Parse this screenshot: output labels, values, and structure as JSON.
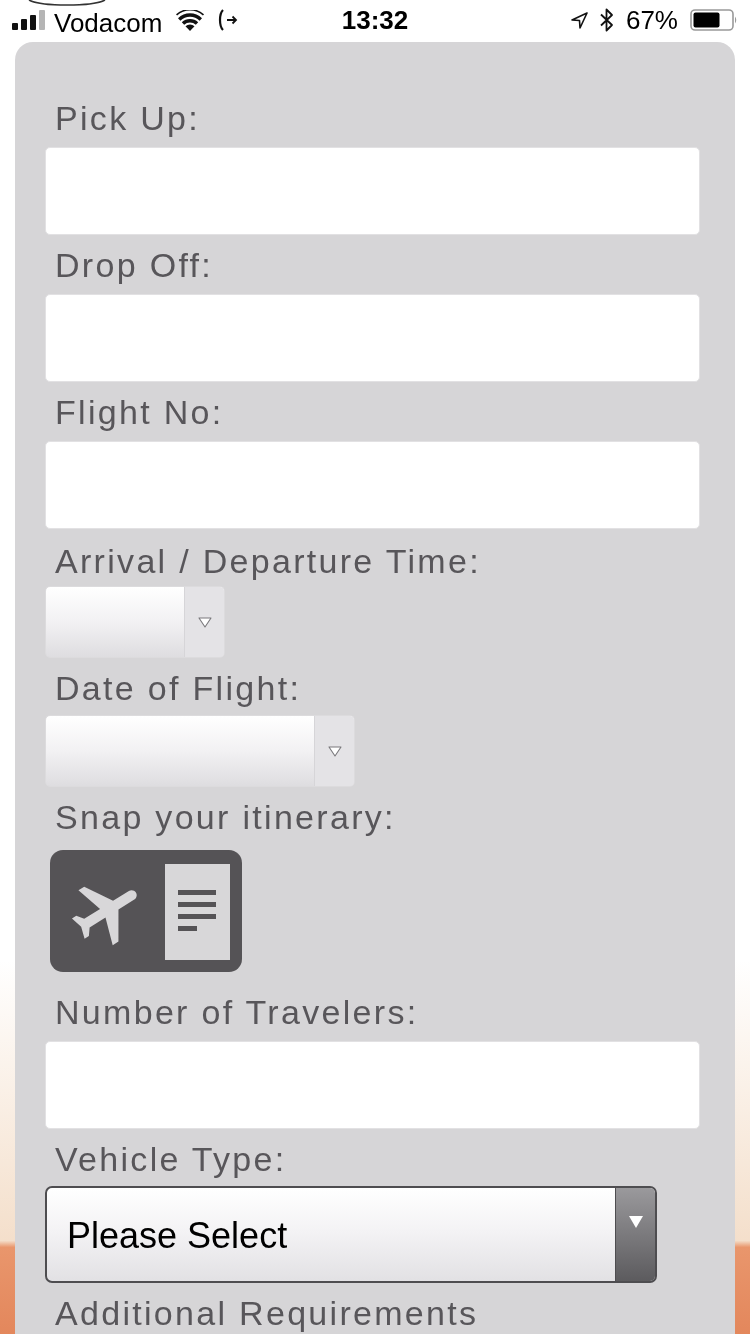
{
  "status_bar": {
    "carrier": "Vodacom",
    "time": "13:32",
    "battery": "67%"
  },
  "form": {
    "fields": [
      {
        "kind": "text",
        "label": "Pick Up:"
      },
      {
        "kind": "text",
        "label": "Drop Off:"
      },
      {
        "kind": "text",
        "label": "Flight No:"
      },
      {
        "kind": "time",
        "label": "Arrival / Departure Time:"
      },
      {
        "kind": "date",
        "label": "Date of Flight:"
      },
      {
        "kind": "upload",
        "label": "Snap your itinerary:"
      },
      {
        "kind": "text",
        "label": "Number of Travelers:"
      },
      {
        "kind": "select",
        "label": "Vehicle Type:",
        "value": "Please Select"
      }
    ],
    "next_label": "Additional Requirements"
  }
}
